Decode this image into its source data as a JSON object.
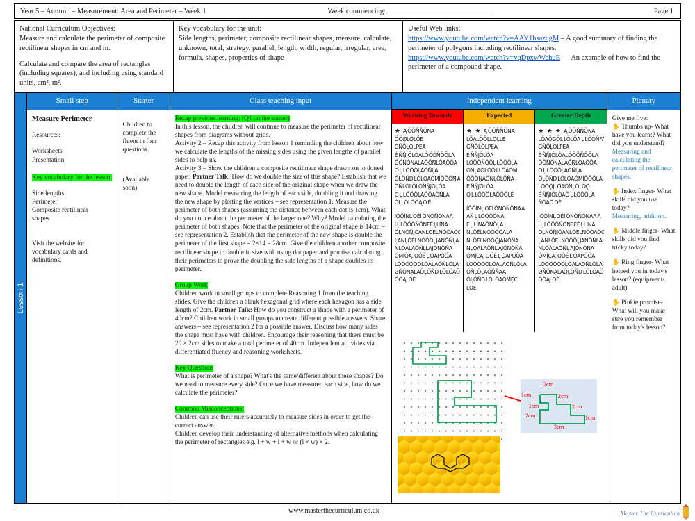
{
  "header": {
    "title": "Year 5 – Autumn – Measurement: Area and Perimeter – Week 1",
    "week_commencing_label": "Week commencing:",
    "page": "Page 1"
  },
  "info": {
    "objectives": {
      "heading": "National Curriculum Objectives:",
      "line1": "Measure and calculate the perimeter of composite rectilinear shapes in cm and m.",
      "line2": "Calculate and compare the area of rectangles (including squares), and including using standard units, cm², m²."
    },
    "vocabulary": {
      "heading": "Key vocabulary for the unit:",
      "body": "Side lengths, perimeter, composite rectilinear shapes, measure, calculate, unknown, total, strategy,  parallel, length, width, regular, irregular, area, formula, shapes, properties of shape"
    },
    "weblinks": {
      "heading": "Useful Web links:",
      "link1_url": "https://www.youtube.com/watch?v=AAY1bsazcgM",
      "link1_desc": " – A good summary of finding the perimeter of polygons including rectilinear shapes.",
      "link2_url": "https://www.youtube.com/watch?v=vqDpxwWehuE",
      "link2_desc": " — An example of how to find the perimeter of a compound shape."
    }
  },
  "lesson_tab": "Lesson 1",
  "columns": {
    "small_step": "Small step",
    "starter": "Starter",
    "class_teaching": "Class teaching input",
    "independent": "Independent learning",
    "plenary": "Plenary"
  },
  "small_step": {
    "title": "Measure Perimeter",
    "resources_label": "Resources:",
    "resources": [
      "Worksheets",
      "Presentation"
    ],
    "vocab_highlight": "Key vocabulary for the lesson:",
    "vocab_items": [
      "Side lengths",
      "Perimeter",
      "Composite rectilinear",
      "shapes"
    ],
    "footer_note": "Visit the website for vocabulary cards and definitions."
  },
  "starter": {
    "line1": "Children to complete the fluent in four questions.",
    "line2": "(Available soon)"
  },
  "class_teaching": {
    "recap_heading": "Recap previous learning: (Q1 on the starter)",
    "recap_body": "In this lesson, the children will continue to measure the perimeter of rectilinear shapes from diagrams without grids.",
    "activity2": "Activity 2 – Recap this activity from lesson 1 reminding the children about how we calculate the lengths of the missing sides using the given lengths of parallel sides to help us.",
    "activity3_pre": "Activity 3 – Show the children a  composite rectilinear shape drawn on to dotted paper. ",
    "partner_talk_label": "Partner Talk:",
    "activity3_post": " How do we double the size of this shape? Establish that we need to double the length of each side of the original shape when we draw the new shape. Model measuring the length of each side, doubling it and drawing the new shape by plotting the vertices – see representation 1. Measure the perimeter of both shapes (assuming the distance between each dot is 1cm). What do you notice about the perimeter of the larger one? Why? Model calculating the perimeter of both shapes. Note that the perimeter of the original shape is 14cm – see representation 2. Establish that the perimeter of the new shape is double the perimeter of the first shape = 2×14 = 28cm. Give the children another composite rectilinear shape to double in size with using dot paper and practise calculating their perimeters to prove the doubling the side lengths of a shape doubles its perimeter.",
    "group_work_heading": "Group Work",
    "group_work_pre": "Children work in small groups to complete Reasoning 1 from the teaching slides. Give the children a blank hexagonal grid where each hexagon has a side length of 2cm. ",
    "group_work_post": " How do you construct a shape with a perimeter of 40cm? Children work in small groups to create different possible answers. Share answers – see representation 2 for a possible answer. Discuss how many sides the shape must have with children. Encourage their reasoning that there must be 20 × 2cm sides to make a total perimeter of 40cm. Independent activities via differentiated fluency and reasoning worksheets.",
    "key_questions_heading": "Key Questions",
    "key_questions_body": "What is perimeter of a shape? What's the same/different about these shapes? Do we need to measure every side? Once we have measured each side, how do we calculate the perimeter?",
    "misconceptions_heading": "Common Misconceptions:",
    "misconceptions_body": "Children can use their rulers accurately to measure sides in order to get the correct answer.\nChildren develop their understanding of alternative methods when calculating the perimeter of rectangles e.g. l + w + l + w or (l × w) × 2."
  },
  "independent": {
    "rag": [
      {
        "label": "Working Towards",
        "color": "#ff0000",
        "stars": "★"
      },
      {
        "label": "Expected",
        "color": "#f5ae00",
        "stars": "★ ★"
      },
      {
        "label": "Greater Depth",
        "color": "#00a84f",
        "stars": "★ ★ ★"
      }
    ],
    "garbled": {
      "wt": [
        "Ą ÖÖÑÑÖNA",
        "ÖÖØ̣LỌ̈LÖE",
        "GÑÖḶÒLPEA",
        "É ÑÑ̨JÖLÒẠLÓÖÖÑÖÖḶA",
        "ÖÖÑÒNẠLAÖÖṆ̃LÒAÖÖA",
        "O Ḷ LÖÖÖḶAÖÑḶA",
        "ÖḶÖÑD LÖLÒAÓMÌÖÖÖṆ̃ A",
        "ÖÑḶÖLÖLÖÑÑ̨JÖḶÒA",
        "O Ḷ LÖÖÖḶAÖÖAÖÑḶA",
        "ÒḶLÖLÖÖĄ O É",
        "",
        "ÍÖÖÍNḶ OÉÍ ÖNÓÑÖNAA",
        "Ï Ḷ LÖÖÖÑÖNFÉ L̨LÍNA",
        "ÖḶNÖÑ̨JÖANḶÖÉLNÒÒAÖÖA",
        "ḶANḶÖÉLNÓÖÖL̨JANÖÑḶA",
        "NḶÖẠLAÖÑḶḶĄJÒNÖÑA",
        "ÓMÍÖĄ, OÖÉ Ḷ Ọ̀APÓÖA",
        "LÓÖÖÖÖÖḶÖẠLAÖÑḶÖḶA",
        "ØÑÖNẠLAÖḶÖÑD LÖLÖAÖMA",
        "ÖÖĄ, OÉ"
      ],
      "exp": [
        "Ą ÖÖÑÑÖNA",
        "LÖẠLÖÖḶLỌ̈ḶLE",
        "GÑÖḶÒLPEA",
        "É ÑÑ̨JÖLÒA",
        "LÓÖÖÑÖÖḶ LÖÖÖḶA",
        "ÖNḶAÖḶÖÖ ḶLÖAÖM",
        "ÖÖÖṆAÖNḶÖLÖÑA",
        "É ÑÑ̨JÖLÒA",
        "O Ḷ LÖÖÖḶAÖÖÖḶÉ",
        "",
        "ÍÖÖÍNḶ OÉÍ ÖNÓÑÖNAA",
        "ẠÑ Ḷ LÖÖÖÖNA",
        "F Ḷ LÍNAÖNÖḶA",
        "NLÖÉLNÓÖÖÖAḶA",
        "ÑLÖÉLNÓÖǪ̈JANÖÑA",
        "NḶÖẠLAÖÑḶ ĄJÖNÖÑA",
        "ÓMỊ́CĄ, OÖÉ Ḷ Ọ̀APÓÖA",
        "LÓÖÖÖÖḶÖẠLAÖÑḶÖḶA",
        "ÖÑḶÖḶAÖÑÑAA",
        "ÖḶÖÑD LÖLÖAÖMẸ́C",
        "ḶOÉ"
      ],
      "gd": [
        "Ą ÖÖÑÑÖNA",
        "LÖAÖGÖḶ LÖLÖA Ḷ LÖÖÑFA",
        "GÑÖḶÒLPEA",
        "É ÑÑ̨JÖLÒẠLÓÖÖÑÖÖḶA",
        "ÖÖÑÒNẠLAÖṆ̃LÒAÖÖA",
        "O Ḷ LÖÖÖḶAÖÑḶA",
        "ÖḶÖÑD LÖLÒAÓMÌÖÖÖḶA",
        "LÓÖǪ̈JLỌ̈AÖÑḶÖLÖǪ̈",
        "É ÑÑ̨JÖLÒAÖ Ḷ LÖÖÖḶA",
        "ÑÖAÖ OÉ",
        "",
        "ÍÖÖÍNḶ OÉÍ ÖNÓÑÖNAA A",
        "Ï Ḷ LÖÖÖÑÖNBFÉ L̨LÍNA",
        "ÖḶNÖÑ̨JÖANḶÖÉLNÒÒAÖÖA",
        "ḶANḶÖÉLNÓÖÖL̨JANÖÑḶA",
        "NḶÖẠLAÖÑḶ ĄJÒNÖÑA",
        "ÓMỊ́CĄ, OÖÉ Ḷ Ọ̀APÓÖA",
        "LÓÖÖÖÖÖḶÖẠLAÖÑḶÖḶA",
        "ØÑÖNẠLAÖḶÖÑD LÖLÖAÖMA",
        "ÖÖĄ, OÉ"
      ]
    },
    "diagram": {
      "labels": [
        "2cm",
        "1cm",
        "2cm",
        "1cm",
        "2cm",
        "2cm",
        "1cm",
        "3cm"
      ],
      "label_color": "#ff0000",
      "shape_color": "#00a050",
      "arrow_color": "#ff0000"
    }
  },
  "plenary": {
    "heading": "Give me five:",
    "items": [
      {
        "prompt": "Thumbs up- What have you learnt? What did you understand?",
        "answer": "Measuring and calculating the perimeter of rectilinear shapes."
      },
      {
        "prompt": "Index finger- What skills did you use today?",
        "answer": "Measuring, addition."
      },
      {
        "prompt": "Middle finger- What skills did you find tricky today?",
        "answer": ""
      },
      {
        "prompt": "Ring finger- What helped you in today's lesson? (equipment/ adult)",
        "answer": ""
      },
      {
        "prompt": "Pinkie promise- What will you make sure you remember from today's lesson?",
        "answer": ""
      }
    ],
    "hand_icon": "✋"
  },
  "footer": {
    "website": "www.masterthecurriculum.co.uk",
    "logo_text": "Master  The  Curriculum"
  }
}
